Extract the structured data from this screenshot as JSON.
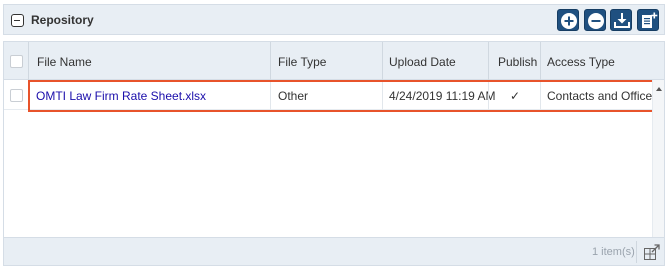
{
  "panel": {
    "title": "Repository",
    "colors": {
      "header_bg": "#e8eef4",
      "button_bg": "#1f5080",
      "highlight": "#e8532b",
      "link": "#1a0dab"
    }
  },
  "toolbar": {
    "buttons": [
      {
        "name": "add-icon"
      },
      {
        "name": "remove-icon"
      },
      {
        "name": "download-icon"
      },
      {
        "name": "add-document-icon"
      }
    ]
  },
  "grid": {
    "columns": [
      "File Name",
      "File Type",
      "Upload Date",
      "Publish",
      "Access Type"
    ],
    "rows": [
      {
        "file_name": "OMTI Law Firm Rate Sheet.xlsx",
        "file_type": "Other",
        "upload_date": "4/24/2019 11:19 AM",
        "publish": "✓",
        "access_type": "Contacts and Office"
      }
    ],
    "footer": {
      "count_text": "1 item(s)"
    }
  }
}
